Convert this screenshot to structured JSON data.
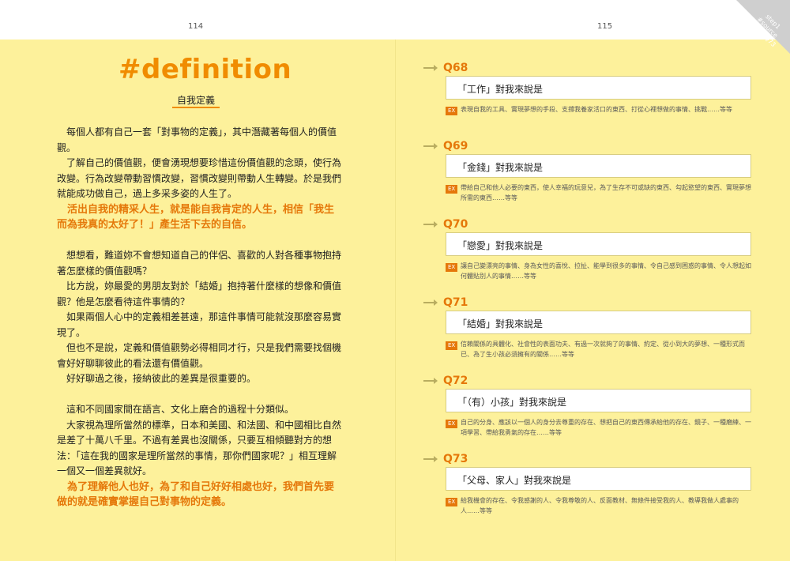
{
  "page_numbers": {
    "left": "114",
    "right": "115"
  },
  "corner_tab": {
    "line1": "step1",
    "line2": "#source",
    "line3": "Q68 — Q73"
  },
  "left": {
    "title": "#definition",
    "subtitle": "自我定義",
    "paragraphs": [
      "每個人都有自己一套「對事物的定義」，其中潛藏著每個人的價值觀。",
      "了解自己的價值觀，便會湧現想要珍惜這份價值觀的念頭，使行為改變。行為改變帶動習慣改變，習慣改變則帶動人生轉變。於是我們就能成功做自己，過上多采多姿的人生了。",
      "想想看，難道妳不會想知道自己的伴侶、喜歡的人對各種事物抱持著怎麼樣的價值觀嗎？",
      "比方說，妳最愛的男朋友對於「結婚」抱持著什麼樣的想像和價值觀？他是怎麼看待這件事情的？",
      "如果兩個人心中的定義相差甚遠，那這件事情可能就沒那麼容易實現了。",
      "但也不是說，定義和價值觀勢必得相同才行，只是我們需要找個機會好好聊聊彼此的看法還有價值觀。",
      "好好聊過之後，接納彼此的差異是很重要的。",
      "這和不同國家間在語言、文化上磨合的過程十分類似。",
      "大家視為理所當然的標準，日本和美國、和法國、和中國相比自然是差了十萬八千里。不過有差異也沒關係，只要互相傾聽對方的想法：「這在我的國家是理所當然的事情，那你們國家呢？」相互理解一個又一個差異就好。"
    ],
    "highlights": [
      "活出自我的精采人生，就是能自我肯定的人生，相信「我生而為我真的太好了！」產生活下去的自信。",
      "為了理解他人也好，為了和自己好好相處也好，我們首先要做的就是確實掌握自己對事物的定義。"
    ]
  },
  "ex_label": "EX",
  "questions": [
    {
      "num": "Q68",
      "prompt": "「工作」對我來說是",
      "example": "表現自我的工具、實現夢想的手段、支撐我養家活口的東西、打從心裡想做的事情、挑戰……等等"
    },
    {
      "num": "Q69",
      "prompt": "「金錢」對我來說是",
      "example": "帶給自己和他人必要的東西，使人幸福的玩意兒，為了生存不可或缺的東西、勾起慾望的東西、實現夢想所需的東西……等等"
    },
    {
      "num": "Q70",
      "prompt": "「戀愛」對我來說是",
      "example": "讓自己變漂亮的事情、身為女性的喜悅、拉扯、能學到很多的事情、令自己感到困惑的事情、令人想起如何體貼別人的事情……等等"
    },
    {
      "num": "Q71",
      "prompt": "「結婚」對我來說是",
      "example": "信賴關係的具體化、社會性的表面功夫、有過一次就夠了的事情、約定、從小到大的夢想、一種形式而已、為了生小孩必須擁有的關係……等等"
    },
    {
      "num": "Q72",
      "prompt": "「（有）小孩」對我來說是",
      "example": "自己的分身、應該以一個人的身分去尊重的存在、想把自己的東西傳承給他的存在、鏡子、一種磨練、一項學習、帶給我勇氣的存在……等等"
    },
    {
      "num": "Q73",
      "prompt": "「父母、家人」對我來說是",
      "example": "給我機會的存在、令我感謝的人、令我尊敬的人、反面教材、無條件接受我的人、教導我做人處事的人……等等"
    }
  ]
}
